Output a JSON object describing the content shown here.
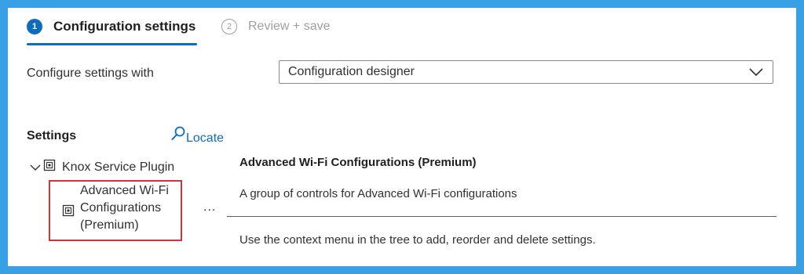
{
  "steps": [
    {
      "number": "1",
      "label": "Configuration settings",
      "state": "active"
    },
    {
      "number": "2",
      "label": "Review + save",
      "state": "inactive"
    }
  ],
  "configure": {
    "label": "Configure settings with",
    "selected": "Configuration designer"
  },
  "settings": {
    "title": "Settings",
    "locate_label": "Locate",
    "tree": {
      "root_label": "Knox Service Plugin",
      "child_lines": [
        "Advanced Wi-Fi",
        "Configurations",
        "(Premium)"
      ]
    },
    "more_label": "..."
  },
  "details": {
    "title": "Advanced Wi-Fi Configurations (Premium)",
    "description": "A group of controls for Advanced Wi-Fi configurations",
    "hint": "Use the context menu in the tree to add, reorder and delete settings."
  },
  "colors": {
    "background": "#3aa0e6",
    "accent": "#0f6cbd",
    "highlight": "#d13438"
  },
  "icons": [
    "chevron-down-icon",
    "search-icon",
    "package-icon"
  ]
}
